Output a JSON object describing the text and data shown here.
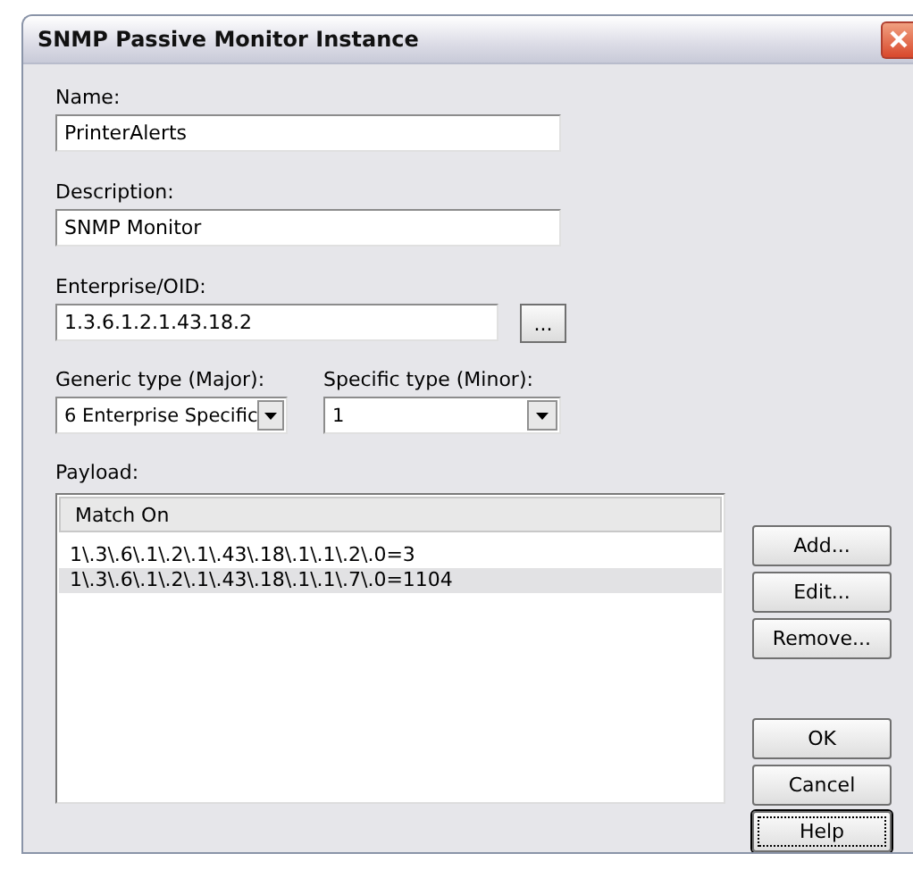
{
  "window": {
    "title": "SNMP Passive Monitor Instance"
  },
  "fields": [
    {
      "label": "Name:",
      "value": "PrinterAlerts"
    },
    {
      "label": "Description:",
      "value": "SNMP Monitor"
    }
  ],
  "enterprise": {
    "label": "Enterprise/OID:",
    "value": "1.3.6.1.2.1.43.18.2",
    "browse": "..."
  },
  "generic_type": {
    "label": "Generic type (Major):",
    "value": "6 Enterprise Specific"
  },
  "specific_type": {
    "label": "Specific type (Minor):",
    "value": "1"
  },
  "payload": {
    "label": "Payload:",
    "column": "Match On",
    "rows": [
      {
        "text": "1\\.3\\.6\\.1\\.2\\.1\\.43\\.18\\.1\\.1\\.2\\.0=3",
        "selected": false
      },
      {
        "text": "1\\.3\\.6\\.1\\.2\\.1\\.43\\.18\\.1\\.1\\.7\\.0=1104",
        "selected": true
      }
    ]
  },
  "side_buttons": [
    {
      "label": "Add...",
      "focused": false
    },
    {
      "label": "Edit...",
      "focused": false
    },
    {
      "label": "Remove...",
      "focused": false
    }
  ],
  "buttons": [
    {
      "label": "OK",
      "focused": false
    },
    {
      "label": "Cancel",
      "focused": false
    },
    {
      "label": "Help",
      "focused": true
    }
  ]
}
